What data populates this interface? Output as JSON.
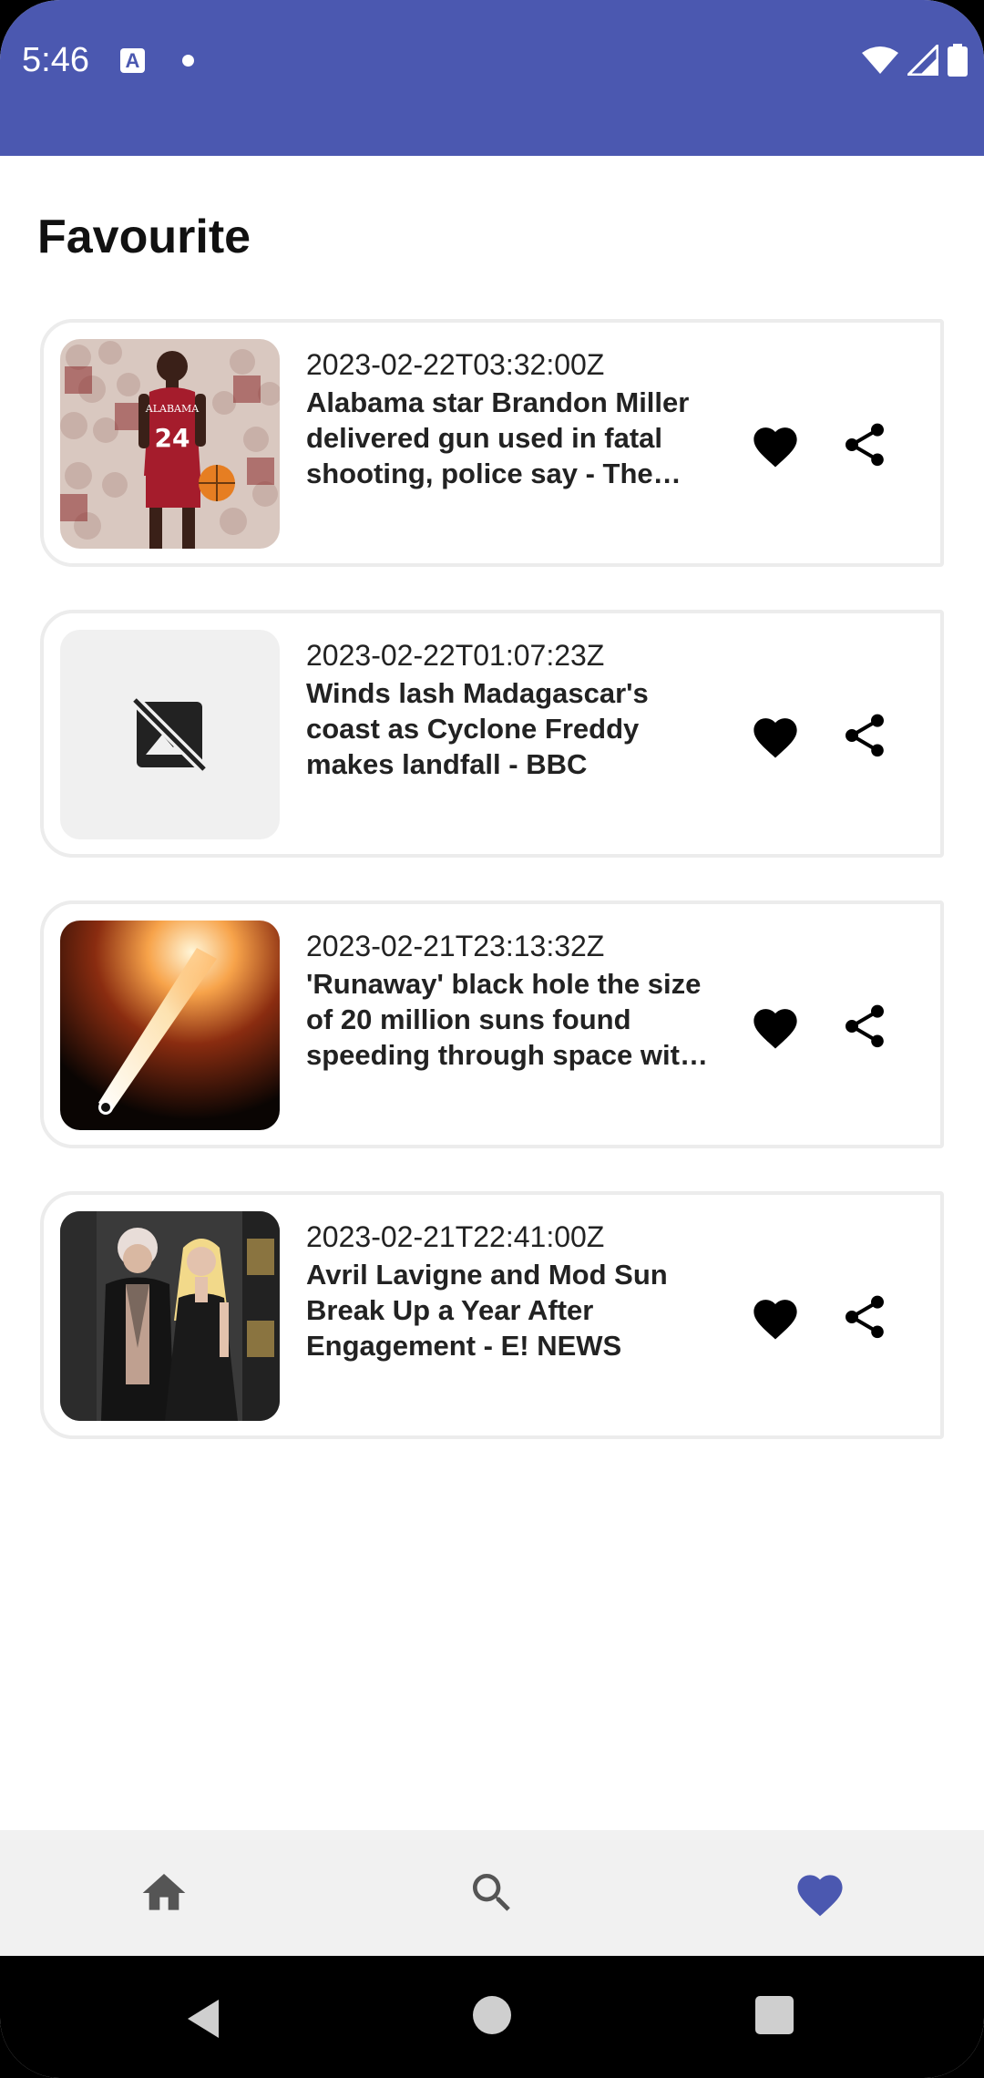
{
  "status_bar": {
    "time": "5:46",
    "notification_letter": "A",
    "icons": [
      "a-notification-icon",
      "dot-icon",
      "wifi-icon",
      "signal-icon",
      "battery-icon"
    ]
  },
  "page": {
    "title": "Favourite"
  },
  "articles": [
    {
      "date": "2023-02-22T03:32:00Z",
      "title": "Alabama star Brandon Miller delivered gun used in fatal shooting, police say - The Washington Post",
      "image": "basketball-player-photo",
      "favourite": true
    },
    {
      "date": "2023-02-22T01:07:23Z",
      "title": "Winds lash Madagascar's coast as Cyclone Freddy makes landfall - BBC",
      "image": "no-image-placeholder",
      "favourite": true
    },
    {
      "date": "2023-02-21T23:13:32Z",
      "title": "'Runaway' black hole the size of 20 million suns found speeding through space with a trail of stars",
      "image": "black-hole-illustration",
      "favourite": true
    },
    {
      "date": "2023-02-21T22:41:00Z",
      "title": "Avril Lavigne and Mod Sun Break Up a Year After Engagement - E! NEWS",
      "image": "couple-red-carpet-photo",
      "favourite": true
    }
  ],
  "bottom_nav": {
    "items": [
      {
        "icon": "home-icon",
        "active": false
      },
      {
        "icon": "search-icon",
        "active": false
      },
      {
        "icon": "heart-icon",
        "active": true
      }
    ]
  },
  "colors": {
    "primary": "#4B58B0",
    "nav_background": "#f1f1f1",
    "card_border": "#ececec",
    "inactive_icon": "#555555"
  }
}
